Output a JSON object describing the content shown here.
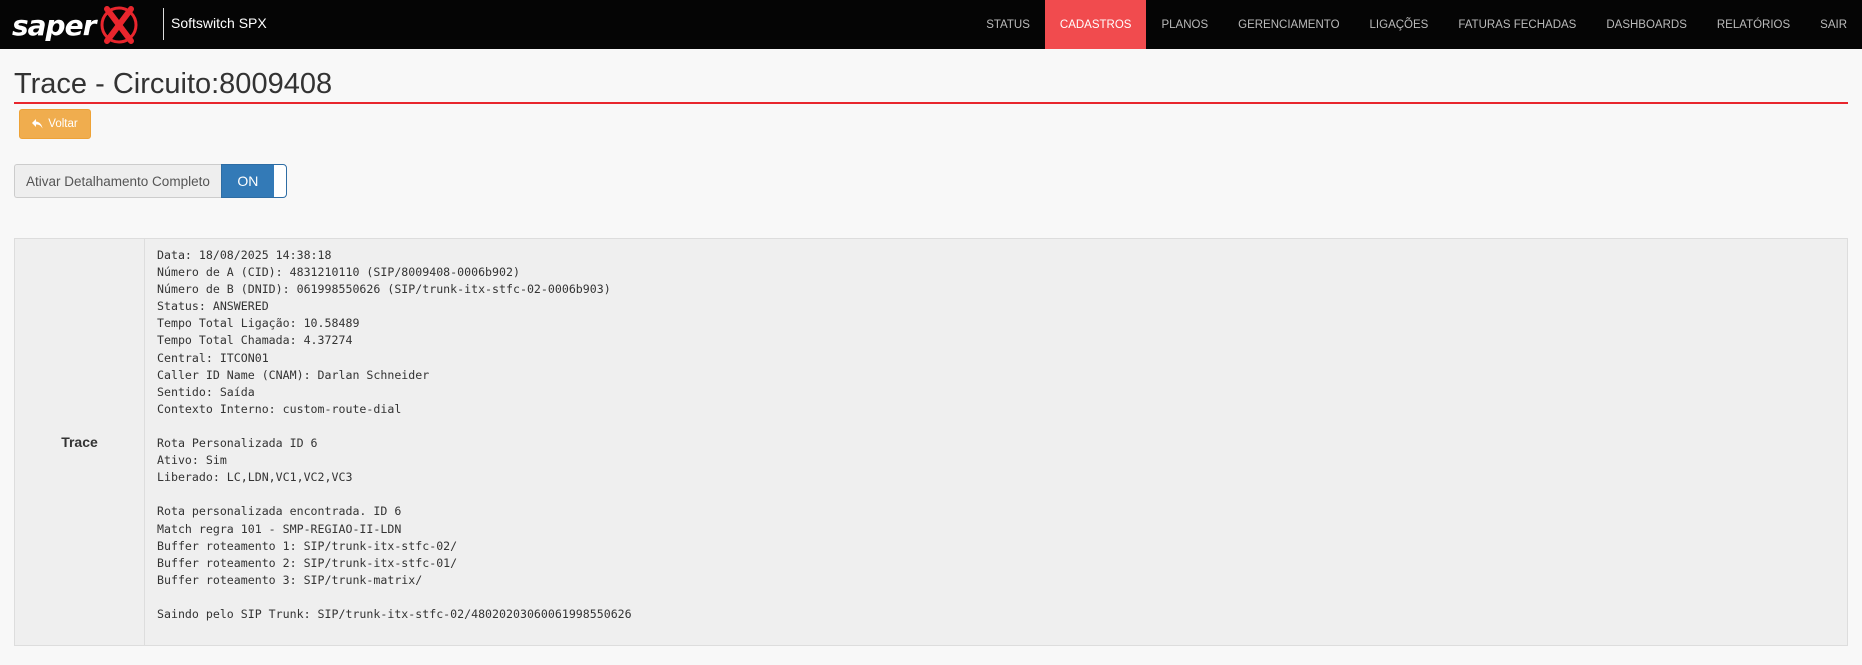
{
  "brand": {
    "wordmark": "saper",
    "mark_letter": "X",
    "subtitle": "Softswitch SPX",
    "accent_color": "#e8262d"
  },
  "nav": {
    "items": [
      {
        "label": "STATUS",
        "active": false
      },
      {
        "label": "CADASTROS",
        "active": true
      },
      {
        "label": "PLANOS",
        "active": false
      },
      {
        "label": "GERENCIAMENTO",
        "active": false
      },
      {
        "label": "LIGAÇÕES",
        "active": false
      },
      {
        "label": "FATURAS FECHADAS",
        "active": false
      },
      {
        "label": "DASHBOARDS",
        "active": false
      },
      {
        "label": "RELATÓRIOS",
        "active": false
      },
      {
        "label": "SAIR",
        "active": false
      }
    ],
    "active_color": "#f14b4e"
  },
  "page": {
    "title": "Trace - Circuito:8009408"
  },
  "back_button": {
    "label": "Voltar",
    "icon": "reply-icon",
    "color": "#f0ad4e"
  },
  "detail_toggle": {
    "label": "Ativar Detalhamento Completo",
    "state_label": "ON",
    "on": true,
    "color": "#337ab7"
  },
  "trace": {
    "header": "Trace",
    "lines": [
      "Data: 18/08/2025 14:38:18",
      "Número de A (CID): 4831210110 (SIP/8009408-0006b902)",
      "Número de B (DNID): 061998550626 (SIP/trunk-itx-stfc-02-0006b903)",
      "Status: ANSWERED",
      "Tempo Total Ligação: 10.58489",
      "Tempo Total Chamada: 4.37274",
      "Central: ITCON01",
      "Caller ID Name (CNAM): Darlan Schneider",
      "Sentido: Saída",
      "Contexto Interno: custom-route-dial",
      "",
      "Rota Personalizada ID 6",
      "Ativo: Sim",
      "Liberado: LC,LDN,VC1,VC2,VC3",
      "",
      "Rota personalizada encontrada. ID 6",
      "Match regra 101 - SMP-REGIAO-II-LDN",
      "Buffer roteamento 1: SIP/trunk-itx-stfc-02/",
      "Buffer roteamento 2: SIP/trunk-itx-stfc-01/",
      "Buffer roteamento 3: SIP/trunk-matrix/",
      "",
      "Saindo pelo SIP Trunk: SIP/trunk-itx-stfc-02/4802020306006199855062​6"
    ]
  }
}
